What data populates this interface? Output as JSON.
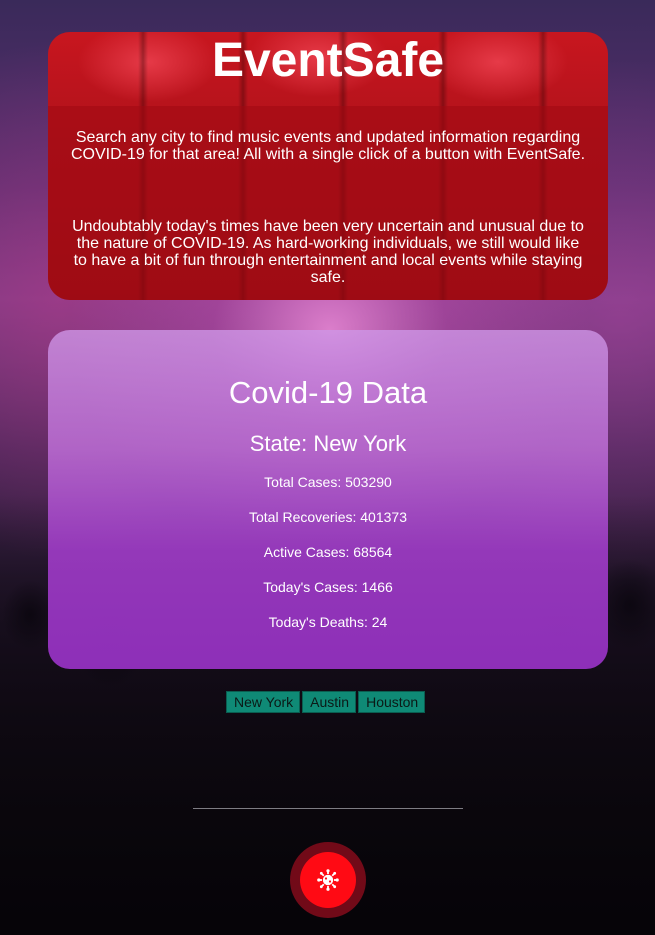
{
  "header": {
    "title": "EventSafe",
    "intro_1": "Search any city to find music events and updated information regarding COVID-19 for that area! All with a single click of a button with EventSafe.",
    "intro_2": "Undoubtably today's times have been very uncertain and unusual due to the nature of COVID-19. As hard-working individuals, we still would like to have a bit of fun through entertainment and local events while staying safe."
  },
  "covid": {
    "title": "Covid-19 Data",
    "state": "State: New York",
    "stats": [
      "Total Cases: 503290",
      "Total Recoveries: 401373",
      "Active Cases: 68564",
      "Today's Cases: 1466",
      "Today's Deaths: 24"
    ]
  },
  "cities": [
    "New York",
    "Austin",
    "Houston"
  ],
  "fab": {
    "icon": "virus-icon"
  },
  "colors": {
    "header_red": "#c8161f",
    "covid_purple": "#8e2fb8",
    "button_teal": "#0f8a76",
    "fab_red": "#ff0a14"
  }
}
